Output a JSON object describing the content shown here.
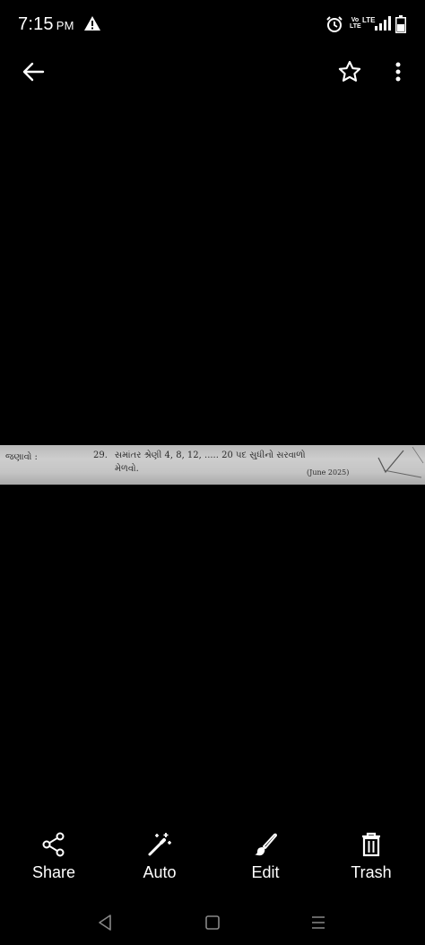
{
  "status_bar": {
    "time": "7:15",
    "ampm": "PM",
    "icons": [
      "warning-icon",
      "alarm-icon",
      "volte-icon",
      "lte-icon",
      "signal-icon",
      "battery-icon"
    ],
    "volte_line1": "Vo",
    "volte_line2": "LTE",
    "lte_label": "LTE"
  },
  "top_bar": {
    "icons": [
      "back-arrow-icon",
      "star-outline-icon",
      "more-vert-icon"
    ]
  },
  "photo": {
    "left_label": "જણાવો :",
    "question_number": "29.",
    "question_line1": "સમાંતર શ્રેણી 4, 8, 12, ..... 20 પદ સુધીનો સરવાળો",
    "question_line2": "મેળવો.",
    "year_note": "(June 2025)"
  },
  "actions": [
    {
      "label": "Share",
      "icon": "share-icon"
    },
    {
      "label": "Auto",
      "icon": "magic-wand-icon"
    },
    {
      "label": "Edit",
      "icon": "brush-icon"
    },
    {
      "label": "Trash",
      "icon": "trash-icon"
    }
  ],
  "nav": {
    "icons": [
      "nav-back-icon",
      "nav-home-icon",
      "nav-menu-icon"
    ]
  },
  "colors": {
    "background": "#000000",
    "foreground": "#ffffff",
    "photo_paper": "#c4c4c4"
  }
}
